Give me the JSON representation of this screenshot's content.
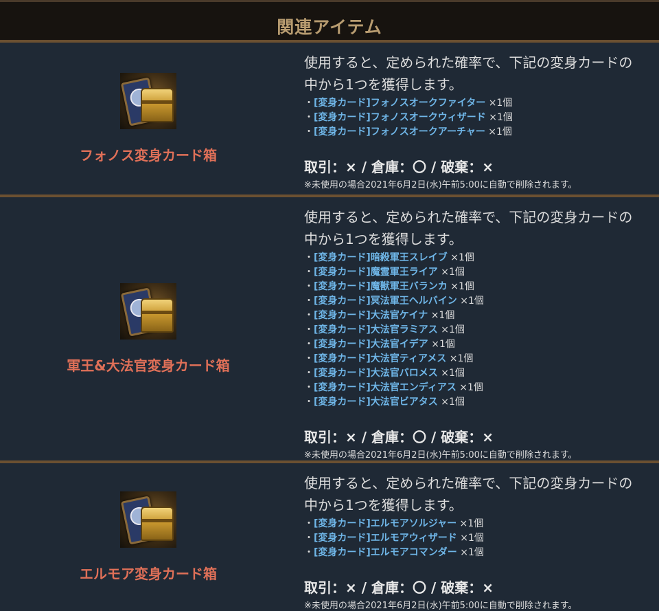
{
  "header": {
    "title": "関連アイテム"
  },
  "items": [
    {
      "name": "フォノス変身カード箱",
      "desc_line1": "使用すると、定められた確率で、下記の変身カードの",
      "desc_line2": "中から1つを獲得します。",
      "cards": [
        {
          "prefix": "・",
          "name": "[変身カード]フォノスオークファイター",
          "qty": " ×1個"
        },
        {
          "prefix": "・",
          "name": "[変身カード]フォノスオークウィザード",
          "qty": " ×1個"
        },
        {
          "prefix": "・",
          "name": "[変身カード]フォノスオークアーチャー",
          "qty": " ×1個"
        }
      ],
      "trade": "取引：× / 倉庫：〇 / 破棄：×",
      "note": "※未使用の場合2021年6月2日(水)午前5:00に自動で削除されます。"
    },
    {
      "name": "軍王&大法官変身カード箱",
      "desc_line1": "使用すると、定められた確率で、下記の変身カードの",
      "desc_line2": "中から1つを獲得します。",
      "cards": [
        {
          "prefix": "・",
          "name": "[変身カード]暗殺軍王スレイブ",
          "qty": " ×1個"
        },
        {
          "prefix": "・",
          "name": "[変身カード]魔霊軍王ライア",
          "qty": " ×1個"
        },
        {
          "prefix": "・",
          "name": "[変身カード]魔獣軍王バランカ",
          "qty": " ×1個"
        },
        {
          "prefix": "・",
          "name": "[変身カード]冥法軍王ヘルバイン",
          "qty": " ×1個"
        },
        {
          "prefix": "・",
          "name": "[変身カード]大法官ケイナ",
          "qty": " ×1個"
        },
        {
          "prefix": "・",
          "name": "[変身カード]大法官ラミアス",
          "qty": " ×1個"
        },
        {
          "prefix": "・",
          "name": "[変身カード]大法官イデア",
          "qty": " ×1個"
        },
        {
          "prefix": "・",
          "name": "[変身カード]大法官ティアメス",
          "qty": " ×1個"
        },
        {
          "prefix": "・",
          "name": "[変身カード]大法官バロメス",
          "qty": " ×1個"
        },
        {
          "prefix": "・",
          "name": "[変身カード]大法官エンディアス",
          "qty": " ×1個"
        },
        {
          "prefix": "・",
          "name": "[変身カード]大法官ビアタス",
          "qty": " ×1個"
        }
      ],
      "trade": "取引：× / 倉庫：〇 / 破棄：×",
      "note": "※未使用の場合2021年6月2日(水)午前5:00に自動で削除されます。"
    },
    {
      "name": "エルモア変身カード箱",
      "desc_line1": "使用すると、定められた確率で、下記の変身カードの",
      "desc_line2": "中から1つを獲得します。",
      "cards": [
        {
          "prefix": "・",
          "name": "[変身カード]エルモアソルジャー",
          "qty": " ×1個"
        },
        {
          "prefix": "・",
          "name": "[変身カード]エルモアウィザード",
          "qty": " ×1個"
        },
        {
          "prefix": "・",
          "name": "[変身カード]エルモアコマンダー",
          "qty": " ×1個"
        }
      ],
      "trade": "取引：× / 倉庫：〇 / 破棄：×",
      "note": "※未使用の場合2021年6月2日(水)午前5:00に自動で削除されます。"
    }
  ]
}
